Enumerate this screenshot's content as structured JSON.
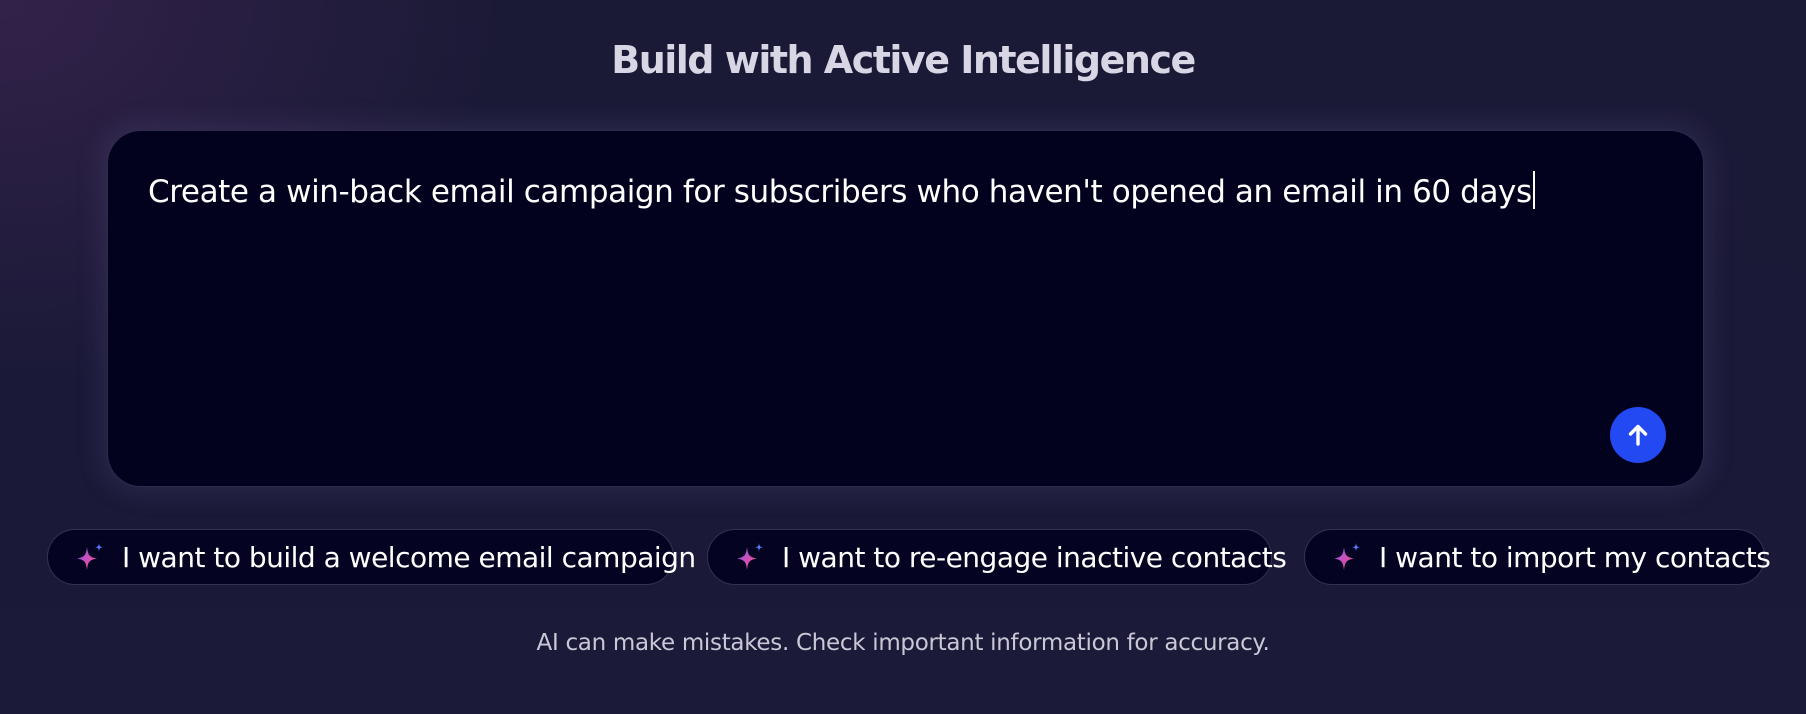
{
  "header": {
    "title": "Build with Active Intelligence"
  },
  "prompt": {
    "value": "Create a win-back email campaign for subscribers who haven't opened an email in 60 days",
    "send_icon": "arrow-up-icon",
    "send_color": "#2349f2"
  },
  "suggestions": [
    {
      "label": "I want to build a welcome email campaign",
      "icon": "sparkle-icon"
    },
    {
      "label": "I want to re-engage inactive contacts",
      "icon": "sparkle-icon"
    },
    {
      "label": "I want to import my contacts",
      "icon": "sparkle-icon"
    }
  ],
  "footer": {
    "disclaimer": "AI can make mistakes. Check important information for accuracy."
  }
}
